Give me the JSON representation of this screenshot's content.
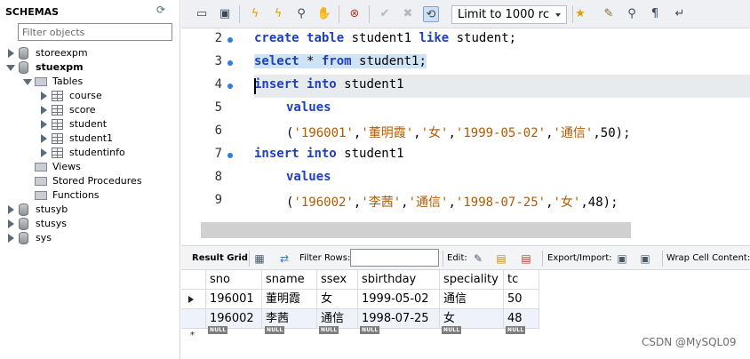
{
  "navigator": {
    "title": "SCHEMAS",
    "filter_placeholder": "Filter objects",
    "schemas": [
      {
        "name": "storeexpm"
      },
      {
        "name": "stuexpm",
        "bold": true
      },
      {
        "name": "stusyb"
      },
      {
        "name": "stusys"
      },
      {
        "name": "sys"
      }
    ],
    "stuexpm_children": {
      "tables_label": "Tables",
      "tables": [
        "course",
        "score",
        "student",
        "student1",
        "studentinfo"
      ],
      "views_label": "Views",
      "procedures_label": "Stored Procedures",
      "functions_label": "Functions"
    }
  },
  "toolbar": {
    "limit_label": "Limit to 1000 rc",
    "icons": [
      "folder-icon",
      "save-icon",
      "execute-icon",
      "execute-line-icon",
      "explain-icon",
      "stop-icon",
      "toggle-error-icon",
      "commit-icon",
      "rollback-icon",
      "autocommit-icon",
      "bookmark-icon",
      "beautify-icon",
      "find-icon",
      "invisible-chars-icon",
      "wrap-icon"
    ]
  },
  "editor": {
    "lines": [
      {
        "num": "2",
        "dot": true
      },
      {
        "num": "3",
        "dot": true
      },
      {
        "num": "4",
        "dot": true
      },
      {
        "num": "5",
        "dot": false
      },
      {
        "num": "6",
        "dot": false
      },
      {
        "num": "7",
        "dot": true
      },
      {
        "num": "8",
        "dot": false
      },
      {
        "num": "9",
        "dot": false
      }
    ],
    "tokens": {
      "l2": {
        "kw1": "create",
        "kw2": "table",
        "t1": " student1 ",
        "kw3": "like",
        "t2": " student;"
      },
      "l3": {
        "kw1": "select",
        "t1": " * ",
        "kw2": "from",
        "t2": " student1;"
      },
      "l4": {
        "kw1": "insert",
        "kw2": "into",
        "t1": " student1"
      },
      "l5": {
        "kw1": "values"
      },
      "l6": {
        "p1": "(",
        "s1": "'196001'",
        "c1": ",",
        "s2": "'董明霞'",
        "c2": ",",
        "s3": "'女'",
        "c3": ",",
        "s4": "'1999-05-02'",
        "c4": ",",
        "s5": "'通信'",
        "c5": ",50);"
      },
      "l7": {
        "kw1": "insert",
        "kw2": "into",
        "t1": " student1"
      },
      "l8": {
        "kw1": "values"
      },
      "l9": {
        "p1": "(",
        "s1": "'196002'",
        "c1": ",",
        "s2": "'李茜'",
        "c2": ",",
        "s3": "'通信'",
        "c3": ",",
        "s4": "'1998-07-25'",
        "c4": ",",
        "s5": "'女'",
        "c5": ",48);"
      }
    }
  },
  "result_toolbar": {
    "result_grid": "Result Grid",
    "filter_rows": "Filter Rows:",
    "edit": "Edit:",
    "export_import": "Export/Import:",
    "wrap": "Wrap Cell Content:"
  },
  "grid": {
    "columns": [
      "sno",
      "sname",
      "ssex",
      "sbirthday",
      "speciality",
      "tc"
    ],
    "rows": [
      [
        "196001",
        "董明霞",
        "女",
        "1999-05-02",
        "通信",
        "50"
      ],
      [
        "196002",
        "李茜",
        "通信",
        "1998-07-25",
        "女",
        "48"
      ]
    ],
    "null_label": "NULL",
    "new_row_marker": "*"
  },
  "watermark": "CSDN @MySQL09"
}
